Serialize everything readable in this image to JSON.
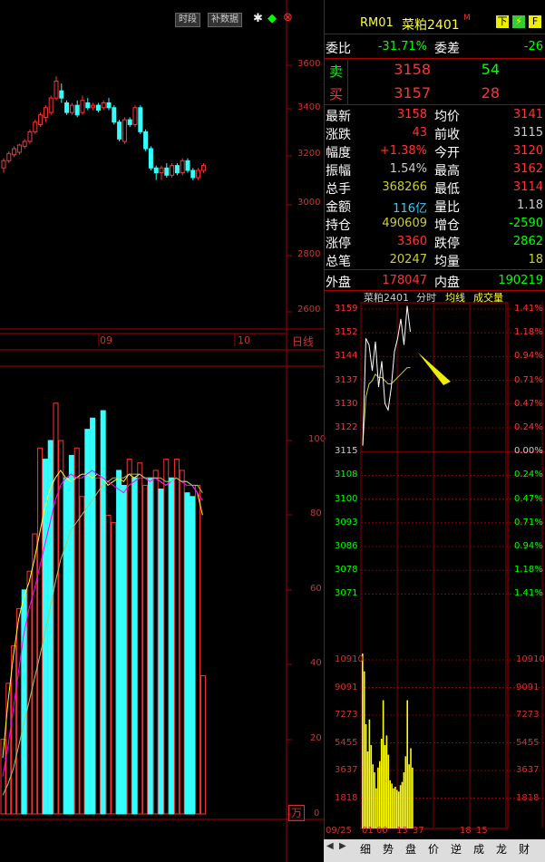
{
  "toolbar": {
    "period_label": "时段",
    "fill_label": "补数据"
  },
  "kline": {
    "price_ticks": [
      "3600",
      "3400",
      "3200",
      "3000",
      "2800",
      "2600"
    ],
    "date_labels": [
      "09",
      "10"
    ],
    "period": "日线",
    "vol_ticks": [
      "100",
      "80",
      "60",
      "40",
      "20",
      "0"
    ],
    "vol_unit": "万"
  },
  "header": {
    "code": "RM01",
    "name": "菜粕2401",
    "flag": "M",
    "down_label": "下",
    "f_label": "F"
  },
  "quote": {
    "weibi_label": "委比",
    "weibi": "-31.71%",
    "weicha_label": "委差",
    "weicha": "-26",
    "sell_label": "卖",
    "sell_price": "3158",
    "sell_vol": "54",
    "buy_label": "买",
    "buy_price": "3157",
    "buy_vol": "28",
    "rows": [
      {
        "l1": "最新",
        "v1": "3158",
        "l2": "均价",
        "v2": "3141",
        "c1": "#f33",
        "c2": "#f33"
      },
      {
        "l1": "涨跌",
        "v1": "43",
        "l2": "前收",
        "v2": "3115",
        "c1": "#f33",
        "c2": "#ccc"
      },
      {
        "l1": "幅度",
        "v1": "+1.38%",
        "l2": "今开",
        "v2": "3120",
        "c1": "#f33",
        "c2": "#f33"
      },
      {
        "l1": "振幅",
        "v1": "1.54%",
        "l2": "最高",
        "v2": "3162",
        "c1": "#ccc",
        "c2": "#f33"
      },
      {
        "l1": "总手",
        "v1": "368266",
        "l2": "最低",
        "v2": "3114",
        "c1": "#cc3",
        "c2": "#f33"
      },
      {
        "l1": "金额",
        "v1": "116亿",
        "l2": "量比",
        "v2": "1.18",
        "c1": "#3cf",
        "c2": "#ccc"
      },
      {
        "l1": "持仓",
        "v1": "490609",
        "l2": "增仓",
        "v2": "-2590",
        "c1": "#cc3",
        "c2": "#0f0"
      },
      {
        "l1": "涨停",
        "v1": "3360",
        "l2": "跌停",
        "v2": "2862",
        "c1": "#f33",
        "c2": "#0f0"
      },
      {
        "l1": "总笔",
        "v1": "20247",
        "l2": "均量",
        "v2": "18",
        "c1": "#cc3",
        "c2": "#cc3"
      }
    ],
    "outer_label": "外盘",
    "outer": "178047",
    "inner_label": "内盘",
    "inner": "190219"
  },
  "intraday": {
    "title_name": "菜粕2401",
    "title_time": "分时",
    "title_avg": "均线",
    "title_vol": "成交量",
    "prices": [
      "3159",
      "3152",
      "3144",
      "3137",
      "3130",
      "3122",
      "3115",
      "3108",
      "3100",
      "3093",
      "3086",
      "3078",
      "3071"
    ],
    "pcts": [
      "1.41%",
      "1.18%",
      "0.94%",
      "0.71%",
      "0.47%",
      "0.24%",
      "0.00%",
      "0.24%",
      "0.47%",
      "0.71%",
      "0.94%",
      "1.18%",
      "1.41%"
    ],
    "vols": [
      "10910",
      "9091",
      "7273",
      "5455",
      "3637",
      "1818"
    ],
    "times": [
      "09/25",
      "01",
      "00",
      "13",
      "37",
      "18",
      "15"
    ]
  },
  "tabs": [
    "细",
    "势",
    "盘",
    "价",
    "逆",
    "成",
    "龙",
    "财"
  ],
  "colors": {
    "up": "#f33",
    "down": "#3ff",
    "avg": "#cc3",
    "grid": "#800"
  }
}
